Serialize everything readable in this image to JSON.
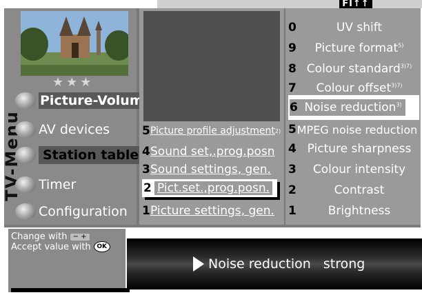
{
  "badge": "FI↑↑",
  "stars": "★★★",
  "side_title": "TV-Menu",
  "main_menu": [
    {
      "id": "picture-volume",
      "label": "Picture-Volume"
    },
    {
      "id": "av-devices",
      "label": "AV devices"
    },
    {
      "id": "station-table",
      "label": "Station table"
    },
    {
      "id": "timer",
      "label": "Timer"
    },
    {
      "id": "configuration",
      "label": "Configuration"
    }
  ],
  "mid_menu": [
    {
      "num": "5",
      "label": "Picture profile adjustment",
      "sup": "2)"
    },
    {
      "num": "4",
      "label": "Sound set,.prog.posn",
      "sup": ""
    },
    {
      "num": "3",
      "label": "Sound settings, gen.",
      "sup": ""
    },
    {
      "num": "2",
      "label": "Pict.set.,prog.posn.",
      "sup": ""
    },
    {
      "num": "1",
      "label": "Picture settings, gen.",
      "sup": ""
    }
  ],
  "right_menu": [
    {
      "num": "0",
      "label": "UV shift",
      "sup": ""
    },
    {
      "num": "9",
      "label": "Picture format",
      "sup": "5)"
    },
    {
      "num": "8",
      "label": "Colour  standard",
      "sup": "3)7)"
    },
    {
      "num": "7",
      "label": "Colour offset",
      "sup": "3)7)"
    },
    {
      "num": "6",
      "label": "Noise reduction",
      "sup": "3)"
    },
    {
      "num": "5",
      "label": "MPEG noise reduction",
      "sup": ""
    },
    {
      "num": "4",
      "label": "Picture sharpness",
      "sup": ""
    },
    {
      "num": "3",
      "label": "Colour intensity",
      "sup": ""
    },
    {
      "num": "2",
      "label": "Contrast",
      "sup": ""
    },
    {
      "num": "1",
      "label": "Brightness",
      "sup": ""
    }
  ],
  "hints": {
    "change_label": "Change with",
    "change_key": "−  +",
    "accept_label": "Accept value with",
    "accept_key": "OK"
  },
  "status": {
    "text": "Noise reduction   strong"
  },
  "colors": {
    "panel_dark": "#7a7a7a",
    "panel_light": "#9a9a9a",
    "highlight": "#ffffff"
  }
}
